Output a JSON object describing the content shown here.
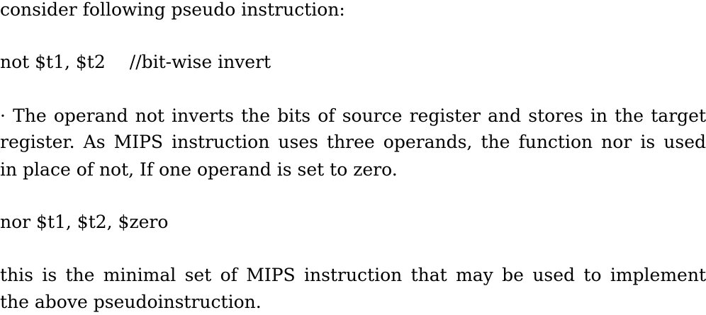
{
  "intro": "consider following pseudo instruction:",
  "pseudo": {
    "code": "not $t1, $t2",
    "comment": "//bit-wise invert"
  },
  "explanation": {
    "line1": "· The operand not inverts the bits of source register and stores in the target",
    "line2": "register. As MIPS instruction uses three operands, the function nor is used",
    "line3": "in place of not, If one operand is set to zero."
  },
  "mips_instruction": "nor $t1, $t2, $zero",
  "conclusion": {
    "line1": "this is the minimal set of MIPS instruction that may be used to implement",
    "line2": "the above pseudoinstruction."
  }
}
